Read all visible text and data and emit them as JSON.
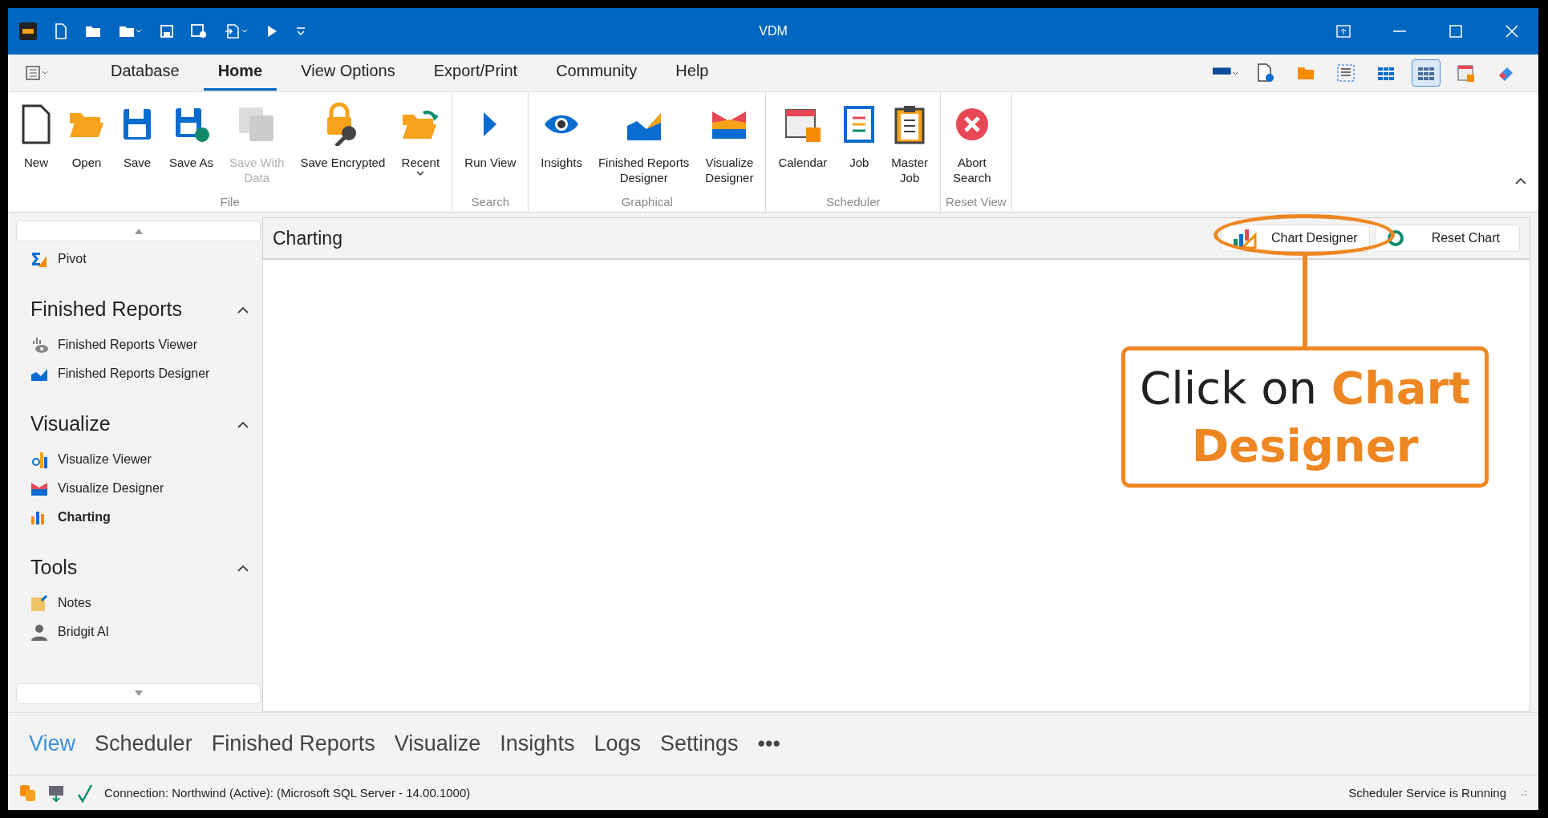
{
  "window": {
    "title": "VDM"
  },
  "menu_tabs": [
    {
      "label": "Database",
      "selected": false
    },
    {
      "label": "Home",
      "selected": true
    },
    {
      "label": "View Options",
      "selected": false
    },
    {
      "label": "Export/Print",
      "selected": false
    },
    {
      "label": "Community",
      "selected": false
    },
    {
      "label": "Help",
      "selected": false
    }
  ],
  "layout_buttons": [
    {
      "selected": false
    },
    {
      "selected": true
    }
  ],
  "ribbon_groups": [
    {
      "title": "File",
      "buttons": [
        {
          "label": "New",
          "disabled": false,
          "has_menu": false
        },
        {
          "label": "Open",
          "disabled": false,
          "has_menu": false
        },
        {
          "label": "Save",
          "disabled": false,
          "has_menu": false
        },
        {
          "label": "Save As",
          "disabled": false,
          "has_menu": false
        },
        {
          "label": "Save With\nData",
          "disabled": true,
          "has_menu": false
        },
        {
          "label": "Save Encrypted",
          "disabled": false,
          "has_menu": false
        },
        {
          "label": "Recent",
          "disabled": false,
          "has_menu": true
        }
      ]
    },
    {
      "title": "Search",
      "buttons": [
        {
          "label": "Run View",
          "disabled": false,
          "has_menu": false
        }
      ]
    },
    {
      "title": "Graphical",
      "buttons": [
        {
          "label": "Insights",
          "disabled": false,
          "has_menu": false
        },
        {
          "label": "Finished Reports\nDesigner",
          "disabled": false,
          "has_menu": false
        },
        {
          "label": "Visualize\nDesigner",
          "disabled": false,
          "has_menu": false
        }
      ]
    },
    {
      "title": "Scheduler",
      "buttons": [
        {
          "label": "Calendar",
          "disabled": false,
          "has_menu": false
        },
        {
          "label": "Job",
          "disabled": false,
          "has_menu": false
        },
        {
          "label": "Master\nJob",
          "disabled": false,
          "has_menu": false
        }
      ]
    },
    {
      "title": "Reset View",
      "buttons": [
        {
          "label": "Abort\nSearch",
          "disabled": false,
          "has_menu": false
        }
      ]
    }
  ],
  "sidebar": {
    "top_items": [
      {
        "label": "Pivot",
        "selected": false
      }
    ],
    "sections": [
      {
        "title": "Finished Reports",
        "expanded": true,
        "items": [
          {
            "label": "Finished Reports Viewer",
            "selected": false
          },
          {
            "label": "Finished Reports Designer",
            "selected": false
          }
        ]
      },
      {
        "title": "Visualize",
        "expanded": true,
        "items": [
          {
            "label": "Visualize Viewer",
            "selected": false
          },
          {
            "label": "Visualize Designer",
            "selected": false
          },
          {
            "label": "Charting",
            "selected": true
          }
        ]
      },
      {
        "title": "Tools",
        "expanded": true,
        "items": [
          {
            "label": "Notes",
            "selected": false
          },
          {
            "label": "Bridgit AI",
            "selected": false
          }
        ]
      }
    ]
  },
  "panel": {
    "title": "Charting",
    "buttons": [
      {
        "label": "Chart Designer"
      },
      {
        "label": "Reset Chart"
      }
    ]
  },
  "callout": {
    "text": "Click on **Chart Designer**"
  },
  "bottom_nav": [
    {
      "label": "View",
      "selected": true
    },
    {
      "label": "Scheduler",
      "selected": false
    },
    {
      "label": "Finished Reports",
      "selected": false
    },
    {
      "label": "Visualize",
      "selected": false
    },
    {
      "label": "Insights",
      "selected": false
    },
    {
      "label": "Logs",
      "selected": false
    },
    {
      "label": "Settings",
      "selected": false
    },
    {
      "label": "•••",
      "selected": false
    }
  ],
  "status_bar": {
    "connection": "Connection: Northwind (Active): (Microsoft SQL Server - 14.00.1000)",
    "scheduler": "Scheduler Service is Running"
  }
}
